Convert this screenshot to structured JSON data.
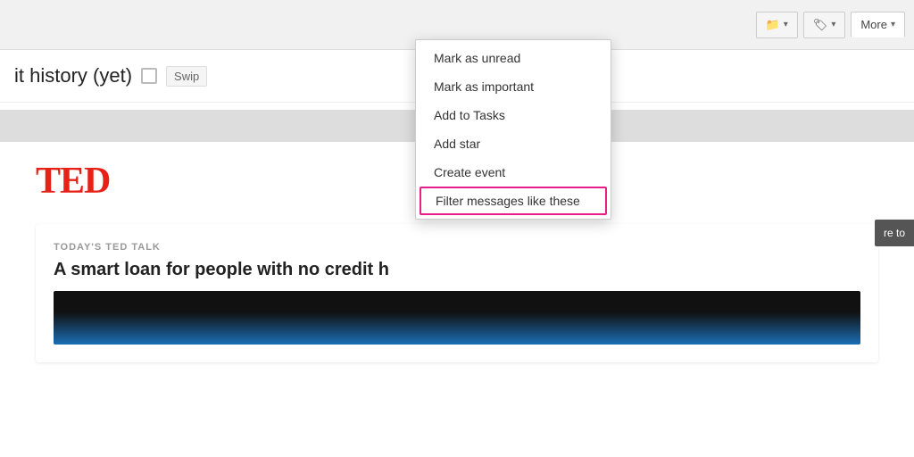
{
  "toolbar": {
    "folder_btn_label": "▾",
    "label_btn_label": "▾",
    "more_btn_label": "More",
    "more_btn_chevron": "▾"
  },
  "email": {
    "subject_partial": "it history (yet)",
    "swipe_label": "Swip",
    "grey_bar_right_hint": "re to"
  },
  "dropdown": {
    "items": [
      {
        "label": "Mark as unread",
        "highlighted": false
      },
      {
        "label": "Mark as important",
        "highlighted": false
      },
      {
        "label": "Add to Tasks",
        "highlighted": false
      },
      {
        "label": "Add star",
        "highlighted": false
      },
      {
        "label": "Create event",
        "highlighted": false
      },
      {
        "label": "Filter messages like these",
        "highlighted": true
      }
    ]
  },
  "ted": {
    "logo": "TED",
    "today_label": "TODAY'S TED TALK",
    "talk_title": "A smart loan for people with no credit h"
  }
}
